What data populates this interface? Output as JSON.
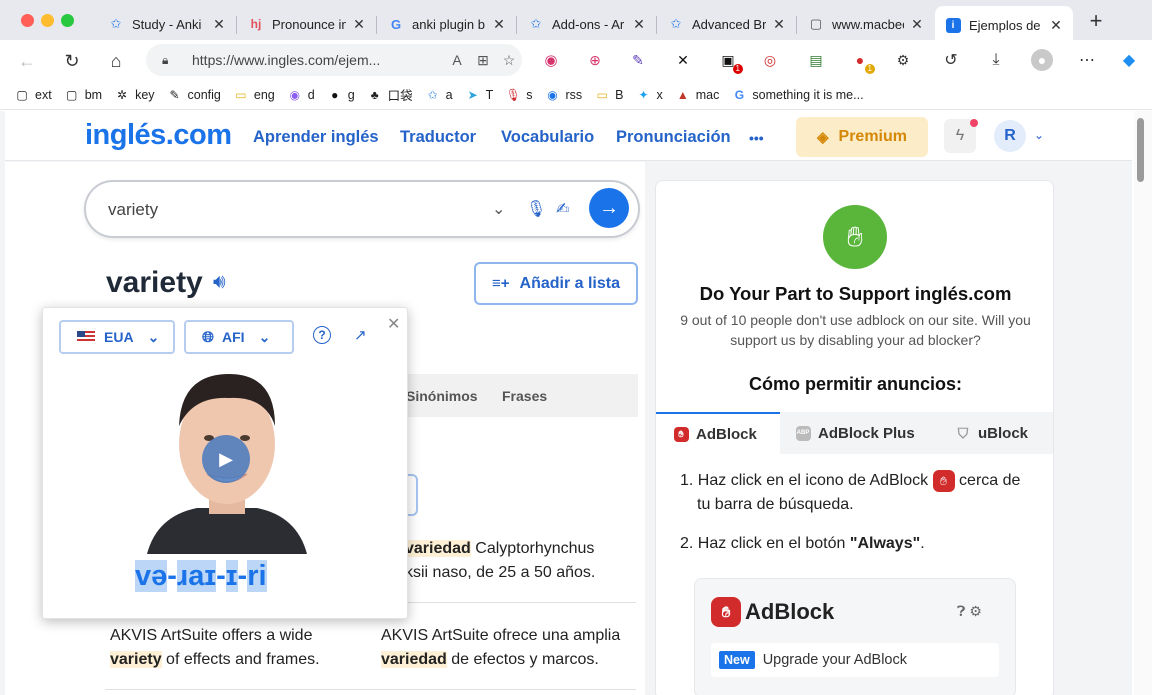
{
  "browser": {
    "tabs": [
      {
        "title": "Study - Anki",
        "icon": "anki-star-icon"
      },
      {
        "title": "Pronounce in",
        "icon": "hj-icon"
      },
      {
        "title": "anki plugin b",
        "icon": "google-icon"
      },
      {
        "title": "Add-ons - Ar",
        "icon": "anki-star-icon"
      },
      {
        "title": "Advanced Br",
        "icon": "anki-star-icon"
      },
      {
        "title": "www.macbec",
        "icon": "page-icon"
      },
      {
        "title": "Ejemplos de",
        "icon": "info-icon"
      }
    ],
    "url": "https://www.ingles.com/ejem...",
    "ext_badges": [
      "1",
      "1"
    ],
    "bookmarks": [
      {
        "label": "ext",
        "icon": "page-icon"
      },
      {
        "label": "bm",
        "icon": "page-icon"
      },
      {
        "label": "key",
        "icon": "puzzle-icon"
      },
      {
        "label": "config",
        "icon": "brush-icon"
      },
      {
        "label": "eng",
        "icon": "folder-icon"
      },
      {
        "label": "d",
        "icon": "purple-app-icon"
      },
      {
        "label": "g",
        "icon": "github-icon"
      },
      {
        "label": "口袋",
        "icon": "glyph-icon"
      },
      {
        "label": "a",
        "icon": "anki-star-icon"
      },
      {
        "label": "T",
        "icon": "telegram-icon"
      },
      {
        "label": "s",
        "icon": "mic-icon"
      },
      {
        "label": "rss",
        "icon": "rss-icon"
      },
      {
        "label": "B",
        "icon": "folder-icon"
      },
      {
        "label": "x",
        "icon": "twitter-icon"
      },
      {
        "label": "mac",
        "icon": "mac-icon"
      },
      {
        "label": "something it is me...",
        "icon": "google-icon"
      }
    ]
  },
  "site": {
    "logo": "inglés.com",
    "nav": [
      "Aprender inglés",
      "Traductor",
      "Vocabulario",
      "Pronunciación",
      "•••"
    ],
    "premium": "Premium",
    "avatar": "R"
  },
  "search": {
    "value": "variety"
  },
  "entry": {
    "word": "variety",
    "add_list": "Añadir a lista",
    "tabs": [
      "Sinónimos",
      "Frases"
    ],
    "examples": [
      {
        "es_line1_bold": "variedad",
        "es_line1_rest": " Calyptorhynchus",
        "es_line2": "ksii naso, de 25 a 50 años."
      },
      {
        "en_line1": "AKVIS ArtSuite offers a wide",
        "en_line2_bold": "variety",
        "en_line2_rest": " of effects and frames.",
        "es_line1": "AKVIS ArtSuite ofrece una amplia",
        "es_line2_bold": "variedad",
        "es_line2_rest": " de efectos y marcos."
      }
    ]
  },
  "popup": {
    "region": "EUA",
    "notation": "AFI",
    "ipa_parts": [
      "və",
      "-",
      "ɹaɪ",
      "-",
      "ɪ",
      "-",
      "ri"
    ]
  },
  "adcard": {
    "title": "Do Your Part to Support inglés.com",
    "subtitle_1": "9 out of 10 people don't use adblock on our site. Will you",
    "subtitle_2": "support us by disabling your ad blocker?",
    "how_title": "Cómo permitir anuncios:",
    "tabs": [
      "AdBlock",
      "AdBlock Plus",
      "uBlock"
    ],
    "step1_a": "1. Haz click en el icono de AdBlock",
    "step1_b": " cerca de",
    "step1_c": "tu barra de búsqueda.",
    "step2_a": "2. Haz click en el botón ",
    "step2_b": "\"Always\"",
    "step2_c": ".",
    "ablogo": "AdBlock",
    "new_badge": "New",
    "upgrade": "Upgrade your AdBlock"
  },
  "colors": {
    "brand": "#1a73e8",
    "premium_text": "#d48806",
    "premium_bg": "#fdecc8",
    "highlight": "#fdf0d5"
  }
}
